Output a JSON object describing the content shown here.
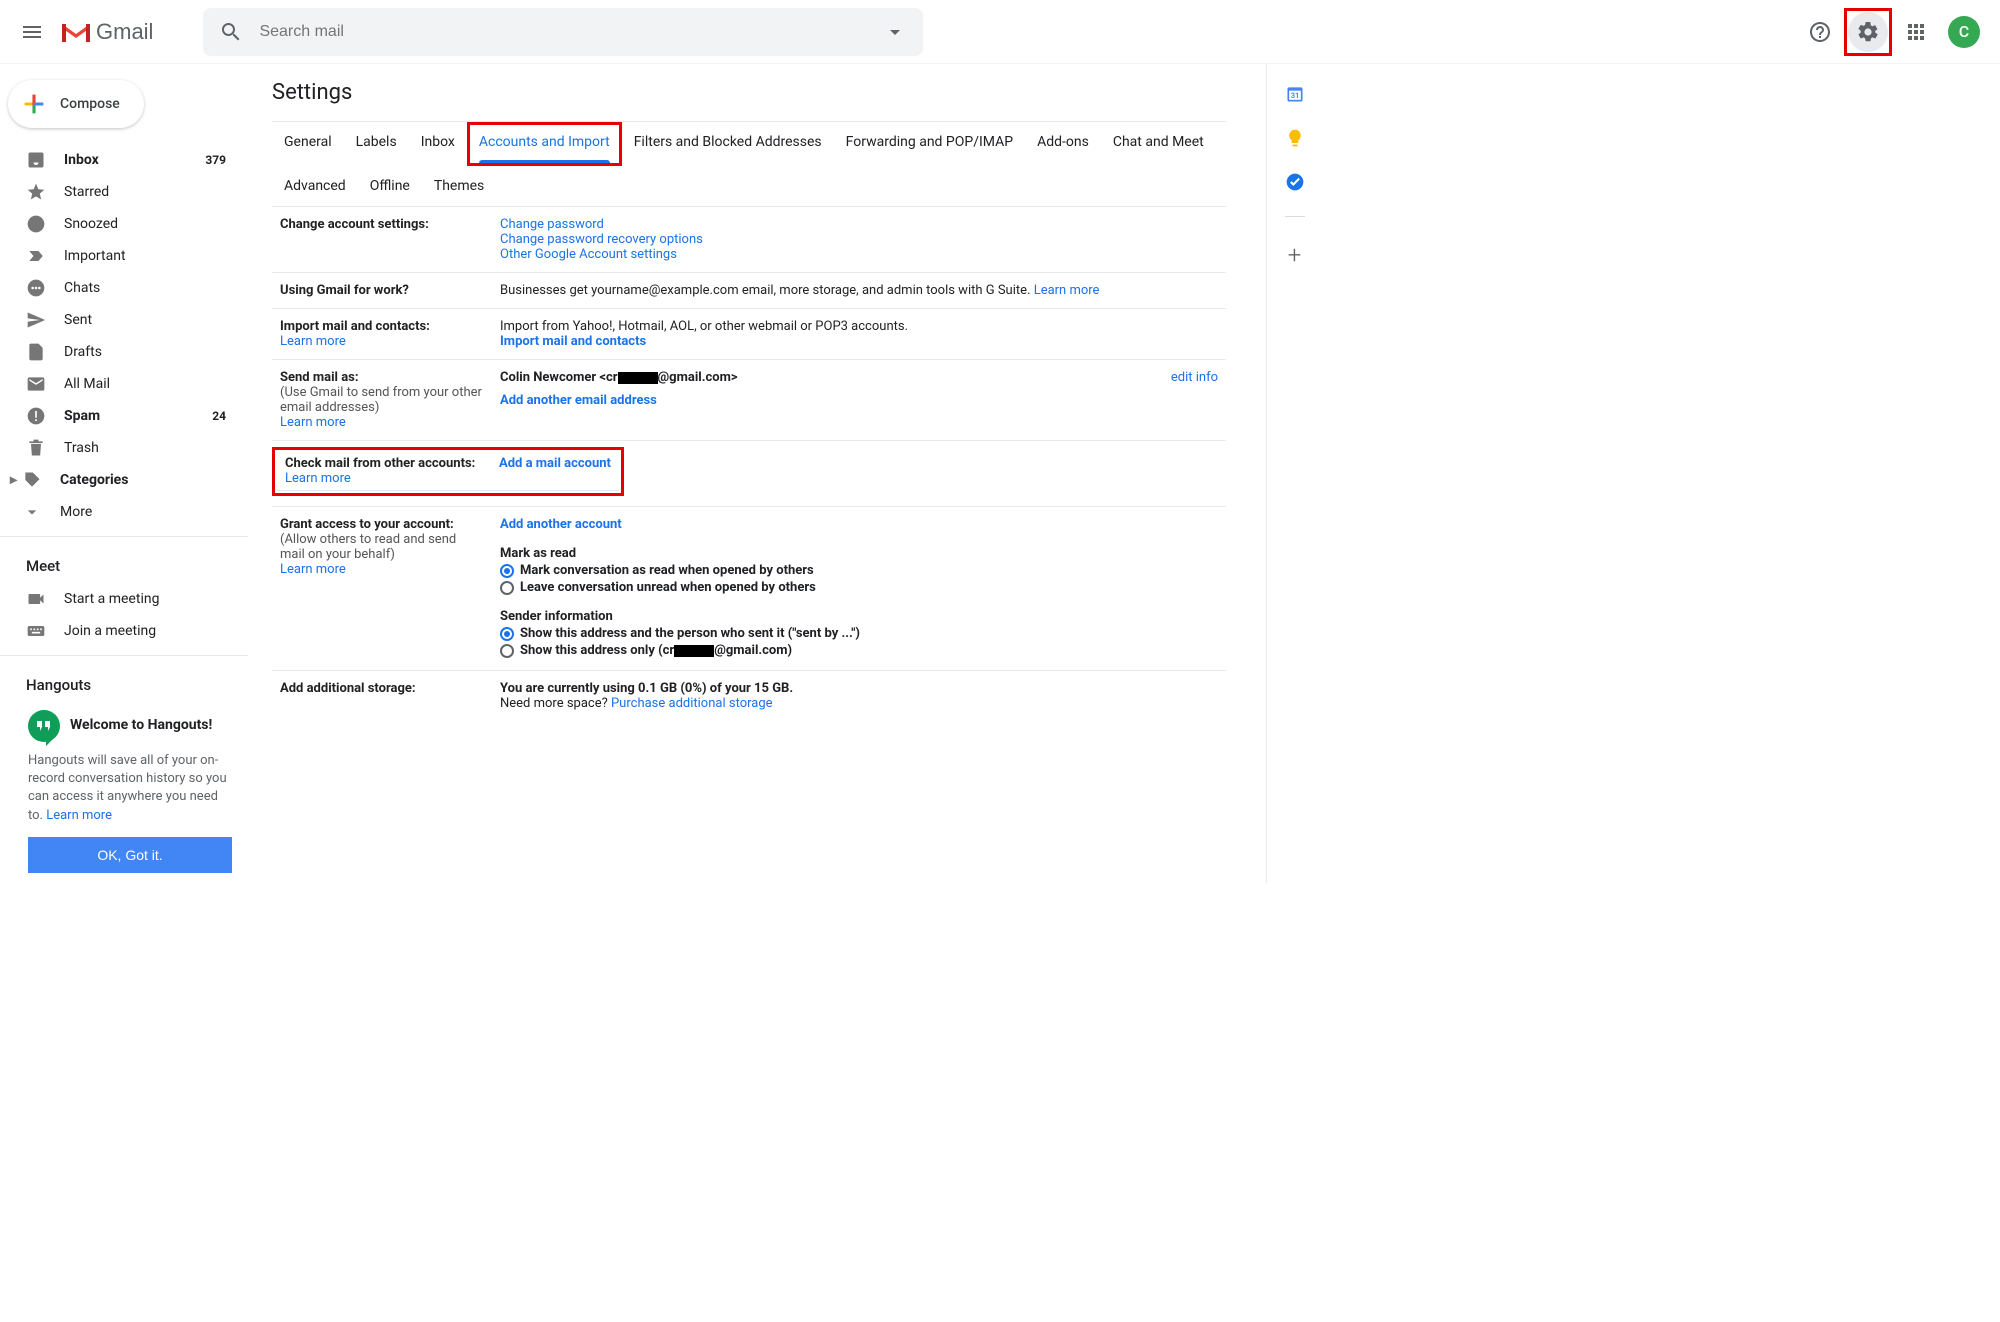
{
  "header": {
    "product": "Gmail",
    "search_placeholder": "Search mail",
    "avatar_letter": "C"
  },
  "sidebar": {
    "compose": "Compose",
    "items": [
      {
        "label": "Inbox",
        "count": "379",
        "bold": true,
        "icon": "inbox"
      },
      {
        "label": "Starred",
        "icon": "star"
      },
      {
        "label": "Snoozed",
        "icon": "clock"
      },
      {
        "label": "Important",
        "icon": "important"
      },
      {
        "label": "Chats",
        "icon": "chats"
      },
      {
        "label": "Sent",
        "icon": "sent"
      },
      {
        "label": "Drafts",
        "icon": "drafts"
      },
      {
        "label": "All Mail",
        "icon": "allmail"
      },
      {
        "label": "Spam",
        "count": "24",
        "bold": true,
        "icon": "spam"
      },
      {
        "label": "Trash",
        "icon": "trash"
      },
      {
        "label": "Categories",
        "bold": true,
        "icon": "categories"
      },
      {
        "label": "More",
        "icon": "more"
      }
    ],
    "meet_header": "Meet",
    "meet_items": [
      {
        "label": "Start a meeting",
        "icon": "video"
      },
      {
        "label": "Join a meeting",
        "icon": "keyboard"
      }
    ],
    "hangouts_header": "Hangouts",
    "hangouts_welcome": "Welcome to Hangouts!",
    "hangouts_body": "Hangouts will save all of your on-record conversation history so you can access it anywhere you need to. ",
    "hangouts_learn": "Learn more",
    "hangouts_ok": "OK, Got it."
  },
  "content": {
    "title": "Settings",
    "tabs": [
      "General",
      "Labels",
      "Inbox",
      "Accounts and Import",
      "Filters and Blocked Addresses",
      "Forwarding and POP/IMAP",
      "Add-ons",
      "Chat and Meet",
      "Advanced",
      "Offline",
      "Themes"
    ],
    "active_tab": "Accounts and Import",
    "rows": {
      "change": {
        "label": "Change account settings:",
        "links": [
          "Change password",
          "Change password recovery options",
          "Other Google Account settings"
        ]
      },
      "work": {
        "label": "Using Gmail for work?",
        "text": "Businesses get yourname@example.com email, more storage, and admin tools with G Suite. ",
        "learn": "Learn more"
      },
      "import": {
        "label": "Import mail and contacts:",
        "learn": "Learn more",
        "text": "Import from Yahoo!, Hotmail, AOL, or other webmail or POP3 accounts.",
        "action": "Import mail and contacts"
      },
      "send": {
        "label": "Send mail as:",
        "sub": "(Use Gmail to send from your other email addresses)",
        "learn": "Learn more",
        "identity_prefix": "Colin Newcomer <cr",
        "identity_suffix": "@gmail.com>",
        "action": "Add another email address",
        "edit": "edit info"
      },
      "check": {
        "label": "Check mail from other accounts:",
        "learn": "Learn more",
        "action": "Add a mail account"
      },
      "grant": {
        "label": "Grant access to your account:",
        "sub": "(Allow others to read and send mail on your behalf)",
        "learn": "Learn more",
        "action": "Add another account",
        "mark_head": "Mark as read",
        "mark_opt1": "Mark conversation as read when opened by others",
        "mark_opt2": "Leave conversation unread when opened by others",
        "sender_head": "Sender information",
        "sender_opt1": "Show this address and the person who sent it (\"sent by ...\")",
        "sender_opt2_pre": "Show this address only (cr",
        "sender_opt2_post": "@gmail.com)"
      },
      "storage": {
        "label": "Add additional storage:",
        "text1": "You are currently using 0.1 GB (0%) of your 15 GB.",
        "text2": "Need more space? ",
        "purchase": "Purchase additional storage"
      }
    }
  }
}
